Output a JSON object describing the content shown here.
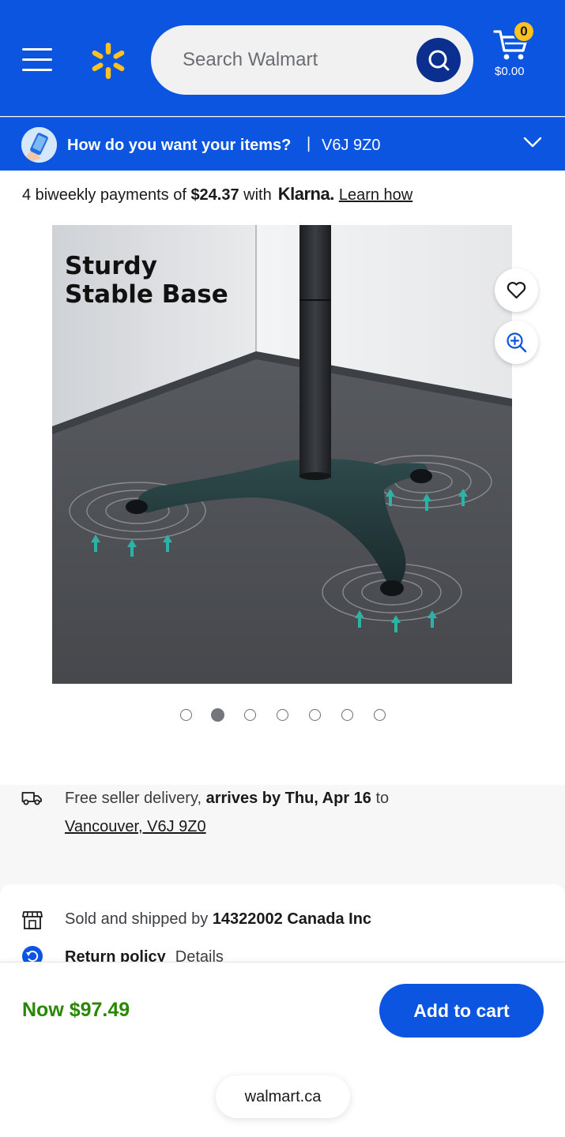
{
  "header": {
    "search_placeholder": "Search Walmart",
    "cart_count": "0",
    "cart_total": "$0.00",
    "brand_color": "#0b55e0",
    "spark_color": "#ffc220"
  },
  "delivery_bar": {
    "question": "How do you want your items?",
    "separator": "|",
    "postal_code": "V6J 9Z0"
  },
  "klarna": {
    "prefix": "4 biweekly payments of ",
    "amount": "$24.37",
    "with": " with",
    "logo": "Klarna.",
    "link": "Learn how"
  },
  "product": {
    "image_caption_line1": "Sturdy",
    "image_caption_line2": "Stable Base",
    "carousel_total": 7,
    "carousel_active": 2
  },
  "shipping": {
    "prefix": "Free seller delivery, ",
    "arrival": "arrives by Thu, Apr 16",
    "suffix": " to",
    "location": "Vancouver, V6J 9Z0"
  },
  "seller": {
    "prefix": "Sold and shipped by ",
    "name": "14322002 Canada Inc"
  },
  "returns": {
    "label": "Return policy",
    "details": "Details"
  },
  "buy_bar": {
    "price": "Now $97.49",
    "price_color": "#2a8703",
    "add_to_cart": "Add to cart"
  },
  "browser": {
    "url": "walmart.ca"
  }
}
